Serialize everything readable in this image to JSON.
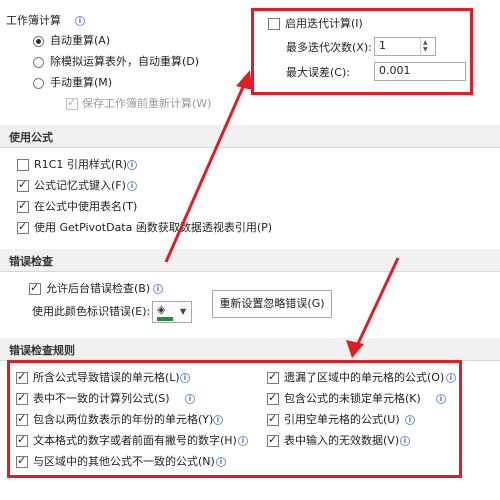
{
  "calc": {
    "title": "工作簿计算",
    "auto": "自动重算(A)",
    "auto_except_tables": "除模拟运算表外，自动重算(D)",
    "manual": "手动重算(M)",
    "save_recalc": "保存工作簿前重新计算(W)"
  },
  "iteration": {
    "enable": "启用迭代计算(I)",
    "max_iterations_label": "最多迭代次数(X):",
    "max_iterations_value": "1",
    "max_change_label": "最大误差(C):",
    "max_change_value": "0.001"
  },
  "formulas": {
    "header": "使用公式",
    "r1c1": "R1C1 引用样式(R)",
    "autocomplete": "公式记忆式键入(F)",
    "table_names": "在公式中使用表名(T)",
    "getpivot": "使用 GetPivotData 函数获取数据透视表引用(P)"
  },
  "error_check": {
    "header": "错误检查",
    "enable_bg": "允许后台错误检查(B)",
    "color_label": "使用此颜色标识错误(E):",
    "reset_button": "重新设置忽略错误(G)"
  },
  "rules": {
    "header": "错误检查规则",
    "left": [
      "所含公式导致错误的单元格(L)",
      "表中不一致的计算列公式(S)",
      "包含以两位数表示的年份的单元格(Y)",
      "文本格式的数字或者前面有撇号的数字(H)",
      "与区域中的其他公式不一致的公式(N)"
    ],
    "right": [
      "遗漏了区域中的单元格的公式(O)",
      "包含公式的未锁定单元格(K)",
      "引用空单元格的公式(U)",
      "表中输入的无效数据(V)"
    ]
  },
  "colors": {
    "accent_red": "#e31b23",
    "header_bg": "#f1f1f1",
    "info_blue": "#3f6fd1"
  }
}
